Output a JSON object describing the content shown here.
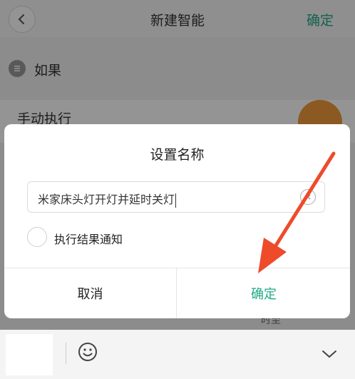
{
  "header": {
    "title": "新建智能",
    "confirm_label": "确定"
  },
  "if_section": {
    "label": "如果"
  },
  "manual_row": {
    "label": "手动执行"
  },
  "bg_side_text": "时至",
  "dialog": {
    "title": "设置名称",
    "name_input_value": "米家床头灯开灯并延时关灯",
    "notify_label": "执行结果通知",
    "cancel_label": "取消",
    "ok_label": "确定"
  },
  "colors": {
    "accent": "#1faa85",
    "arrow": "#ee4b2b",
    "orange": "#f09a3a"
  },
  "icons": [
    "chevron-left-icon",
    "list-icon",
    "clear-icon",
    "arrow-annotation",
    "emoji-icon",
    "chevron-down-icon"
  ]
}
